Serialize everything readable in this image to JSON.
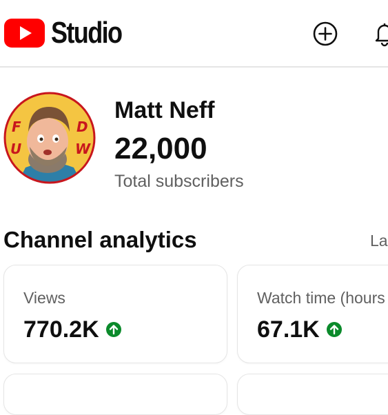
{
  "header": {
    "app_name": "Studio",
    "logo_icon": "youtube-play-icon",
    "create_icon": "add-circle-icon",
    "notifications_icon": "bell-icon",
    "brand_color": "#ff0000"
  },
  "channel": {
    "name": "Matt Neff",
    "subscriber_count": "22,000",
    "subscriber_label": "Total subscribers",
    "avatar_text": {
      "left": "FU",
      "right": "DW"
    }
  },
  "analytics": {
    "title": "Channel analytics",
    "link_label": "La",
    "cards": [
      {
        "label": "Views",
        "value": "770.2K",
        "trend": "up"
      },
      {
        "label": "Watch time (hours",
        "value": "67.1K",
        "trend": "up"
      }
    ],
    "trend_color": "#0b8a2b"
  }
}
